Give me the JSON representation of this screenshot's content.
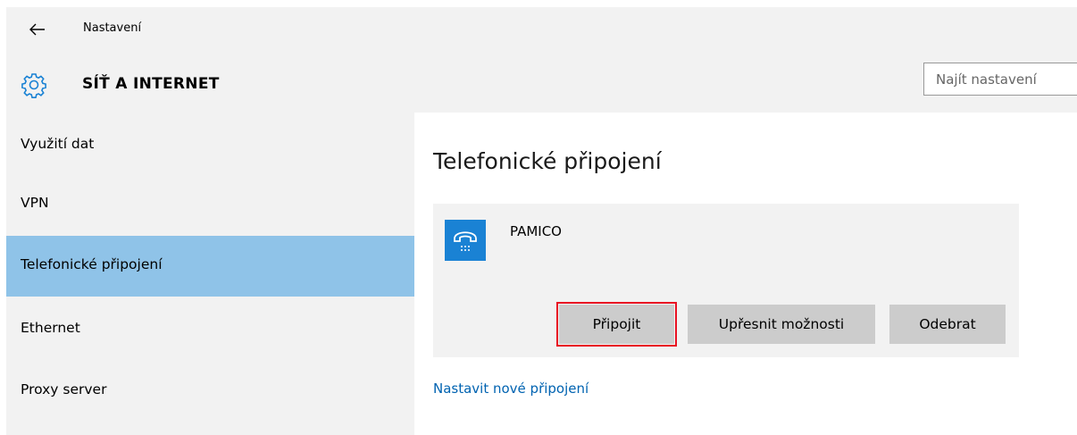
{
  "window": {
    "title": "Nastavení",
    "back_icon": "back-arrow-icon"
  },
  "header": {
    "section_title": "SÍŤ A INTERNET",
    "section_icon": "gear-icon",
    "search": {
      "placeholder": "Najít nastavení",
      "value": ""
    }
  },
  "sidebar": {
    "items": [
      {
        "label": "Využití dat",
        "active": false
      },
      {
        "label": "VPN",
        "active": false
      },
      {
        "label": "Telefonické připojení",
        "active": true
      },
      {
        "label": "Ethernet",
        "active": false
      },
      {
        "label": "Proxy server",
        "active": false
      }
    ]
  },
  "main": {
    "title": "Telefonické připojení",
    "connection": {
      "name": "PAMICO",
      "icon": "dial-up-phone-icon",
      "buttons": {
        "connect": "Připojit",
        "advanced": "Upřesnit možnosti",
        "remove": "Odebrat"
      }
    },
    "new_connection_link": "Nastavit nové připojení"
  },
  "colors": {
    "accent": "#1a82d4",
    "selected_nav": "#8fc3e8",
    "link": "#0063b1",
    "highlight_border": "#e81123",
    "panel_bg": "#f2f2f2",
    "button_bg": "#cccccc"
  }
}
